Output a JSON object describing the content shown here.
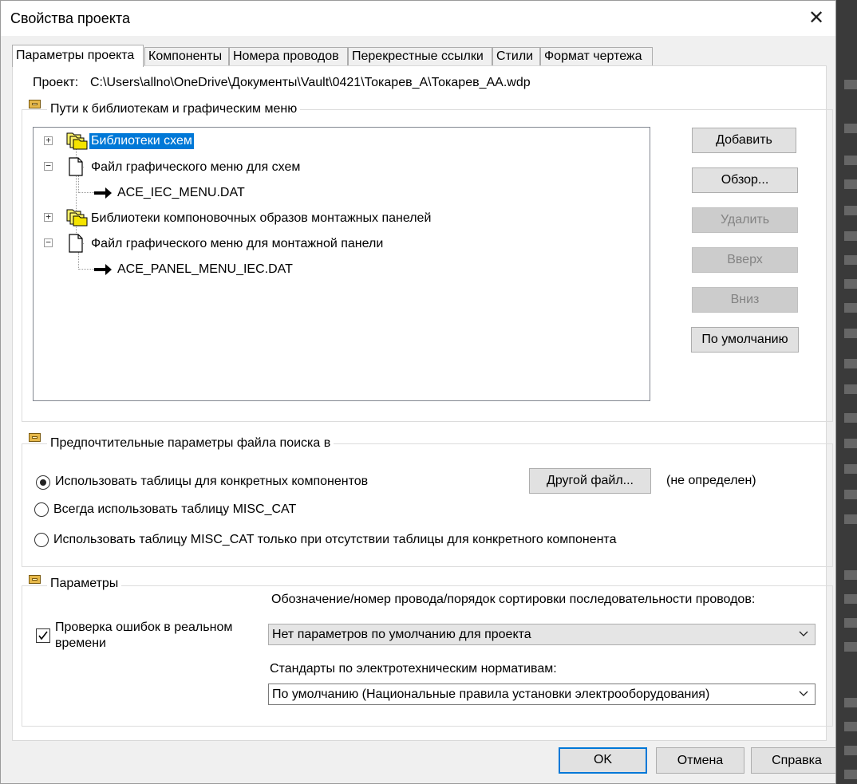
{
  "dialog": {
    "title": "Свойства проекта"
  },
  "tabs": [
    {
      "label": "Параметры проекта"
    },
    {
      "label": "Компоненты"
    },
    {
      "label": "Номера проводов"
    },
    {
      "label": "Перекрестные ссылки"
    },
    {
      "label": "Стили"
    },
    {
      "label": "Формат чертежа"
    }
  ],
  "project": {
    "label": "Проект:",
    "path": "C:\\Users\\allno\\OneDrive\\Документы\\Vault\\0421\\Токарев_А\\Токарев_АА.wdp"
  },
  "paths_group": {
    "title": "Пути к библиотекам и графическим меню",
    "tree": [
      {
        "label": "Библиотеки схем",
        "icon": "folders-icon",
        "expander": "+"
      },
      {
        "label": "Файл графического меню для схем",
        "icon": "document-icon",
        "expander": "−"
      },
      {
        "label": "ACE_IEC_MENU.DAT",
        "icon": "arrow-icon"
      },
      {
        "label": "Библиотеки компоновочных образов монтажных панелей",
        "icon": "folders-icon",
        "expander": "+"
      },
      {
        "label": "Файл графического меню для монтажной панели",
        "icon": "document-icon",
        "expander": "−"
      },
      {
        "label": "ACE_PANEL_MENU_IEC.DAT",
        "icon": "arrow-icon"
      }
    ],
    "buttons": {
      "add": "Добавить",
      "browse": "Обзор...",
      "delete": "Удалить",
      "up": "Вверх",
      "down": "Вниз",
      "default": "По умолчанию"
    }
  },
  "lookup_group": {
    "title": "Предпочтительные параметры файла поиска в",
    "options": [
      {
        "label": "Использовать таблицы для конкретных компонентов",
        "selected": true
      },
      {
        "label": "Всегда использовать таблицу MISC_CAT",
        "selected": false
      },
      {
        "label": "Использовать таблицу MISC_CAT только при отсутствии таблицы для конкретного компонента",
        "selected": false
      }
    ],
    "other_file_button": "Другой файл...",
    "other_file_status": "(не определен)"
  },
  "params_group": {
    "title": "Параметры",
    "realtime_check": {
      "label_line1": "Проверка ошибок в реальном",
      "label_line2": "времени",
      "checked": true
    },
    "wire_label": "Обозначение/номер провода/порядок сортировки последовательности проводов:",
    "wire_value": "Нет параметров по умолчанию для проекта",
    "standards_label": "Стандарты по электротехническим нормативам:",
    "standards_value": "По умолчанию (Национальные правила установки электрооборудования)"
  },
  "footer": {
    "ok": "OK",
    "cancel": "Отмена",
    "help": "Справка"
  },
  "colors": {
    "accent": "#0078d7",
    "selection": "#0078d7",
    "dialog_bg": "#f0f0f0"
  }
}
